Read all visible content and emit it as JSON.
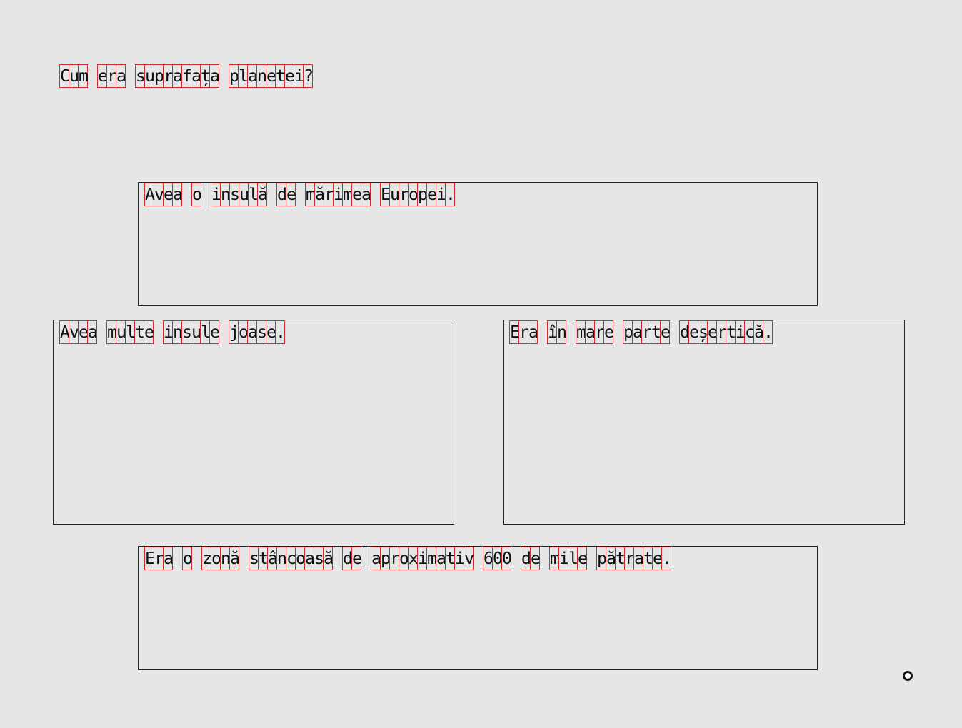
{
  "question": "Cum era suprafața planetei?",
  "options": [
    {
      "id": "opt-a",
      "text": "Avea o insulă de mărimea Europei."
    },
    {
      "id": "opt-b",
      "text": "Avea multe insule joase."
    },
    {
      "id": "opt-c",
      "text": "Era în mare parte deșertică."
    },
    {
      "id": "opt-d",
      "text": "Era o zonă stâncoasă de aproximativ 600 de mile pătrate."
    }
  ],
  "cursor_icon": "ring-cursor-icon"
}
